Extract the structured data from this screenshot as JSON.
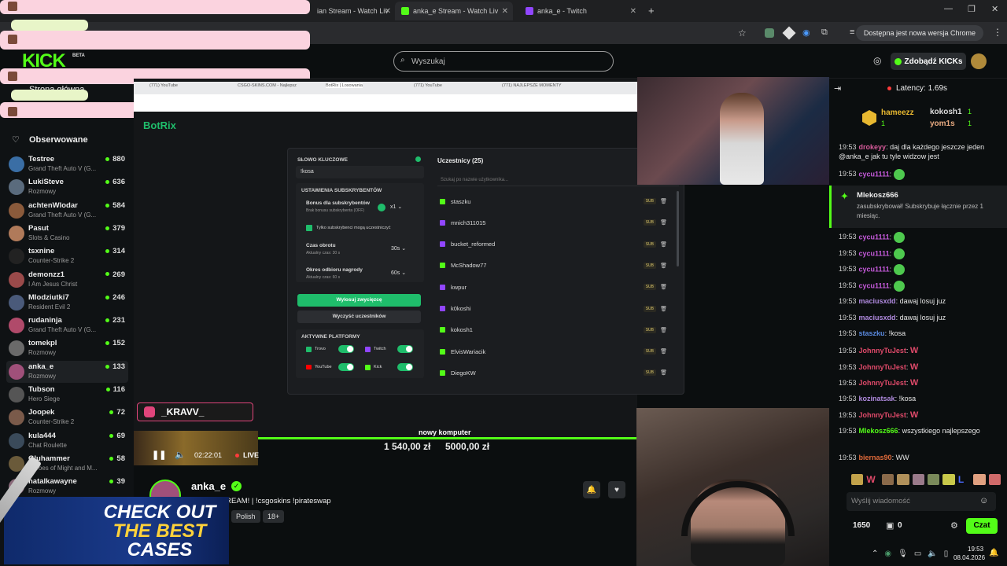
{
  "browser": {
    "tabs": [
      {
        "label": "ian Stream - Watch Liv"
      },
      {
        "label": "anka_e Stream - Watch Liv"
      },
      {
        "label": "anka_e - Twitch"
      }
    ],
    "update_button": "Dostępna jest nowa wersja Chrome"
  },
  "header": {
    "search_placeholder": "Wyszukaj",
    "get_kicks": "Zdobądź KICKs",
    "beta": "BETA"
  },
  "sidebar": {
    "home": "Strona główna",
    "followed": "Obserwowane",
    "channels": [
      {
        "name": "Testree",
        "game": "Grand Theft Auto V (G...",
        "viewers": "880",
        "color": "#3a6ea5"
      },
      {
        "name": "LukiSteve",
        "game": "Rozmowy",
        "viewers": "636",
        "color": "#5a6b7d"
      },
      {
        "name": "achtenWlodar",
        "game": "Grand Theft Auto V (G...",
        "viewers": "584",
        "color": "#8a5a3b"
      },
      {
        "name": "Pasut",
        "game": "Slots & Casino",
        "viewers": "379",
        "color": "#b07a5a"
      },
      {
        "name": "tsxnine",
        "game": "Counter-Strike 2",
        "viewers": "314",
        "color": "#222222"
      },
      {
        "name": "demonzz1",
        "game": "I Am Jesus Christ",
        "viewers": "269",
        "color": "#9a4a4a"
      },
      {
        "name": "Mlodziutki7",
        "game": "Resident Evil 2",
        "viewers": "246",
        "color": "#4a5a7a"
      },
      {
        "name": "rudaninja",
        "game": "Grand Theft Auto V (G...",
        "viewers": "231",
        "color": "#b04a6a"
      },
      {
        "name": "tomekpl",
        "game": "Rozmowy",
        "viewers": "152",
        "color": "#6a6a6a"
      },
      {
        "name": "anka_e",
        "game": "Rozmowy",
        "viewers": "133",
        "color": "#a0507a"
      },
      {
        "name": "Tubson",
        "game": "Hero Siege",
        "viewers": "116",
        "color": "#555555"
      },
      {
        "name": "Joopek",
        "game": "Counter-Strike 2",
        "viewers": "72",
        "color": "#7a5a4a"
      },
      {
        "name": "kula444",
        "game": "Chat Roulette",
        "viewers": "69",
        "color": "#3a4a5a"
      },
      {
        "name": "Gluhammer",
        "game": "Heroes of Might and M...",
        "viewers": "58",
        "color": "#6a5a3a"
      },
      {
        "name": "natalkawayne",
        "game": "Rozmowy",
        "viewers": "39",
        "color": "#8a6a7a"
      }
    ]
  },
  "browser_inner": {
    "tabs": [
      "(771) YouTube",
      "CSGO-SKINS.COM - Najlepsz",
      "BotRix | Losowania",
      "(771) YouTube",
      "(771) NAJLEPSZE MOMENTY"
    ],
    "logo": "BotRix"
  },
  "botrix": {
    "keyword_label": "SŁOWO KLUCZOWE",
    "keyword_value": "!kosa",
    "sub_settings_label": "USTAWIENIA SUBSKRYBENTÓW",
    "sub_bonus_label": "Bonus dla subskrybentów",
    "sub_bonus_desc": "Brak bonusu subskrybenta (OFF)",
    "multiplier": "x1",
    "only_subs": "Tylko subskrybenci mogą uczestniczyć",
    "spin_time_label": "Czas obrotu",
    "spin_time_desc": "Aktualny czas: 30 s",
    "spin_time_value": "30s",
    "claim_label": "Okres odbioru nagrody",
    "claim_desc": "Aktualny czas: 60 s",
    "claim_value": "60s",
    "draw_button": "Wylosuj zwycięzcę",
    "clear_button": "Wyczyść uczestników",
    "platforms_label": "AKTYWNE PLATFORMY",
    "platforms": [
      "Trovo",
      "Twitch",
      "YouTube",
      "Kick"
    ],
    "participants_title": "Uczestnicy (25)",
    "participants_search": "Szukaj po nazwie użytkownika...",
    "sub_tag": "SUB",
    "participants": [
      {
        "name": "staszku",
        "platform": "kick"
      },
      {
        "name": "mnich311015",
        "platform": "twitch"
      },
      {
        "name": "bucket_reformed",
        "platform": "twitch"
      },
      {
        "name": "McShadow77",
        "platform": "kick"
      },
      {
        "name": "kwpur",
        "platform": "twitch"
      },
      {
        "name": "k0koshi",
        "platform": "twitch"
      },
      {
        "name": "kokosh1",
        "platform": "kick"
      },
      {
        "name": "ElvisWariacik",
        "platform": "kick"
      },
      {
        "name": "DiegoKW",
        "platform": "kick"
      }
    ]
  },
  "overlay": {
    "instagram": "_KRAVV_",
    "goal_label": "nowy komputer",
    "goal_current": "1 540,00 zł",
    "goal_target": "5000,00 zł"
  },
  "player": {
    "time": "02:22:01",
    "live": "LIVE"
  },
  "stream_info": {
    "streamer": "anka_e",
    "title": "NOWY STREAM!",
    "title_suffix": "| !csgoskins !pirateswap",
    "tags": [
      "Polish",
      "18+"
    ]
  },
  "ad": {
    "line1": "CHECK OUT",
    "line2": "THE BEST",
    "line3": "CASES"
  },
  "chat": {
    "latency": "Latency: 1.69s",
    "top_gifters": [
      {
        "name": "hameezz",
        "count": "1"
      },
      {
        "name": "kokosh1",
        "count": "1"
      },
      {
        "name": "yom1s",
        "count": "1"
      }
    ],
    "sub_alert_user": "Mlekosz666",
    "sub_alert_text": "zasubskrybował! Subskrybuje łącznie przez 1 miesiąc.",
    "messages": [
      {
        "time": "19:53",
        "user": "drokeyy",
        "color": "#d65a9a",
        "text": "daj dla każdego jeszcze jeden"
      },
      {
        "time": "",
        "user": "",
        "color": "#ffffff",
        "text": "@anka_e jak tu tyle widzow jest"
      },
      {
        "time": "19:53",
        "user": "cycu1111",
        "color": "#c65adb",
        "text": ""
      },
      {
        "time": "19:53",
        "user": "cycu1111",
        "color": "#c65adb",
        "text": ""
      },
      {
        "time": "19:53",
        "user": "cycu1111",
        "color": "#c65adb",
        "text": ""
      },
      {
        "time": "19:53",
        "user": "cycu1111",
        "color": "#c65adb",
        "text": ""
      },
      {
        "time": "19:53",
        "user": "cycu1111",
        "color": "#c65adb",
        "text": ""
      },
      {
        "time": "19:53",
        "user": "maciusxdd",
        "color": "#b08adf",
        "text": "dawaj losuj juz"
      },
      {
        "time": "19:53",
        "user": "maciusxdd",
        "color": "#b08adf",
        "text": "dawaj losuj juz"
      },
      {
        "time": "19:53",
        "user": "staszku",
        "color": "#5a8ae0",
        "text": "!kosa"
      },
      {
        "time": "19:53",
        "user": "JohnnyTuJest",
        "color": "#e04a6a",
        "text": "W"
      },
      {
        "time": "19:53",
        "user": "JohnnyTuJest",
        "color": "#e04a6a",
        "text": "W"
      },
      {
        "time": "19:53",
        "user": "JohnnyTuJest",
        "color": "#e04a6a",
        "text": "W"
      },
      {
        "time": "19:53",
        "user": "kozinatsak",
        "color": "#b08adf",
        "text": "!kosa"
      },
      {
        "time": "19:53",
        "user": "JohnnyTuJest",
        "color": "#e04a6a",
        "text": "W"
      },
      {
        "time": "19:53",
        "user": "Mlekosz666",
        "color": "#53fc18",
        "text": "wszystkiego najlepszego"
      },
      {
        "time": "19:53",
        "user": "biernas90",
        "color": "#e06a3a",
        "text": "WW"
      }
    ],
    "input_placeholder": "Wyślij wiadomość",
    "points": "1650",
    "kicks": "0",
    "send_button": "Czat"
  },
  "taskbar": {
    "time": "19:53",
    "date": "08.04.2026"
  },
  "colors": {
    "kick_green": "#53fc18",
    "botrix_green": "#1fbd6b",
    "pink_overlay": "#fbd3df"
  }
}
